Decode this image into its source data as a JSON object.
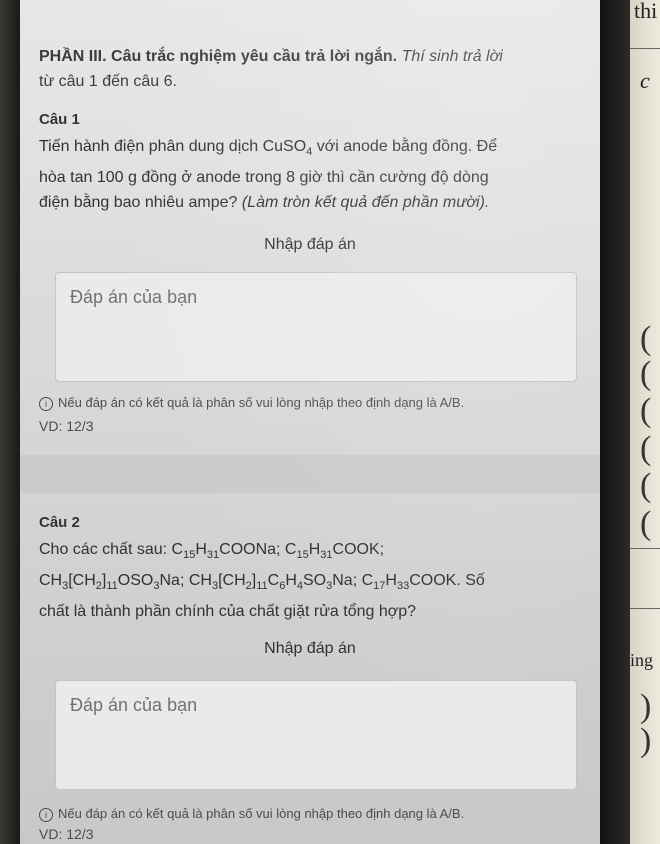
{
  "section": {
    "heading_bold": "PHẦN III. Câu trắc nghiệm yêu cầu trả lời ngắn.",
    "heading_italic": " Thí sinh trả lời",
    "heading_line2": "từ câu 1 đến câu 6."
  },
  "question1": {
    "title": "Câu 1",
    "line1_pre": "Tiến hành điện phân dung dịch CuSO",
    "line1_sub": "4",
    "line1_post": " với anode bằng đồng. Để",
    "line2": "hòa tan 100 g đồng ở anode trong 8 giờ thì cần cường độ dòng",
    "line3_plain": "điện bằng bao nhiêu ampe? ",
    "line3_italic": "(Làm tròn kết quả đến phần mười).",
    "enter_label": "Nhập đáp án",
    "answer_placeholder": "Đáp án của bạn",
    "note": "Nếu đáp án có kết quả là phân số vui lòng nhập theo định dạng là A/B.",
    "example": "VD: 12/3"
  },
  "question2": {
    "title": "Câu 2",
    "line1": "Cho các chất sau:",
    "line2_label": "Số",
    "line3": "chất là thành phần chính của chất giặt rửa tổng hợp?",
    "enter_label": "Nhập đáp án",
    "answer_placeholder": "Đáp án của bạn",
    "note": "Nếu đáp án có kết quả là phân số vui lòng nhập theo định dạng là A/B.",
    "example": "VD: 12/3"
  },
  "paper_fragments": {
    "top": "thi",
    "c": "c",
    "ing": "ing"
  }
}
